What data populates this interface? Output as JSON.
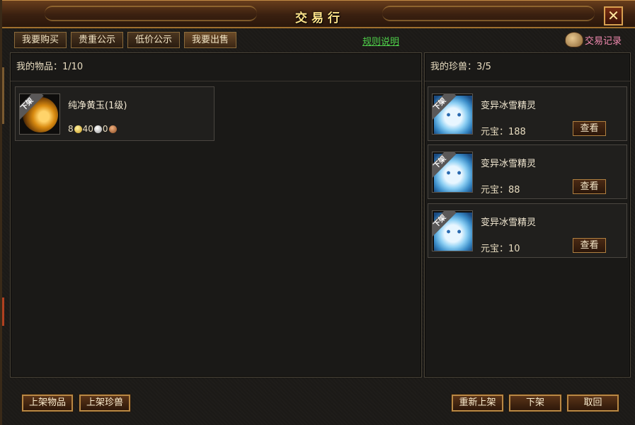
{
  "window": {
    "title": "交易行",
    "close_label": "✕"
  },
  "tabs": [
    {
      "label": "我要购买"
    },
    {
      "label": "贵重公示"
    },
    {
      "label": "低价公示"
    },
    {
      "label": "我要出售"
    }
  ],
  "rules_link": "规则说明",
  "trade_log": {
    "label": "交易记录",
    "icon": "scroll-icon"
  },
  "left_panel": {
    "header": "我的物品：1/10",
    "items": [
      {
        "badge": "下架",
        "name": "纯净黄玉(1级)",
        "price": {
          "gold": "8",
          "silver": "40",
          "copper": "0"
        },
        "icon": "yellow-jade-icon"
      }
    ]
  },
  "right_panel": {
    "header": "我的珍兽：3/5",
    "pets": [
      {
        "badge": "下架",
        "name": "变异冰雪精灵",
        "ingot_label": "元宝：",
        "price": "188",
        "view_label": "查看"
      },
      {
        "badge": "下架",
        "name": "变异冰雪精灵",
        "ingot_label": "元宝：",
        "price": "88",
        "view_label": "查看"
      },
      {
        "badge": "下架",
        "name": "变异冰雪精灵",
        "ingot_label": "元宝：",
        "price": "10",
        "view_label": "查看"
      }
    ]
  },
  "buttons": {
    "list_item": "上架物品",
    "list_pet": "上架珍兽",
    "relist": "重新上架",
    "delist": "下架",
    "retrieve": "取回"
  },
  "colors": {
    "accent_gold": "#ffe48a",
    "link_green": "#4fd04a",
    "log_pink": "#f28ab0"
  }
}
